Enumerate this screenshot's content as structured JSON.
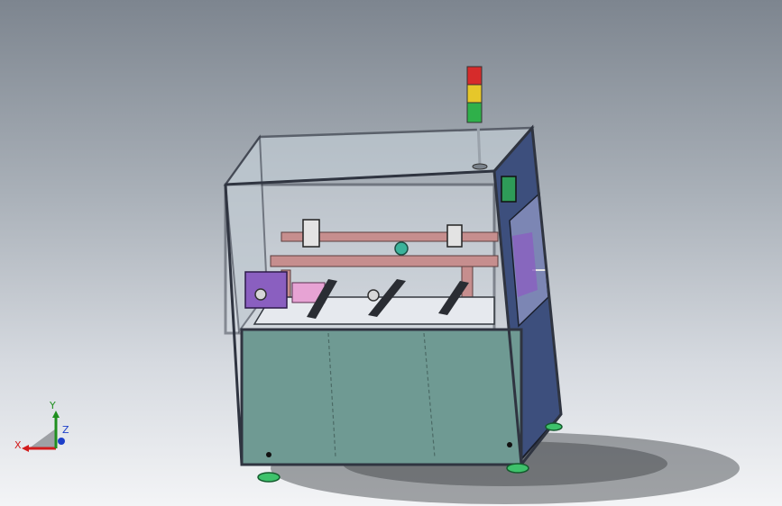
{
  "viewport": {
    "background_top": "#7d858f",
    "background_bottom": "#f3f4f6"
  },
  "model": {
    "frame_color": "#2f3440",
    "panel_color": "#6f9a93",
    "door_color": "#3d4f7d",
    "cover_color": "#c7d2da",
    "carriage_color": "#8a5fc0",
    "rail_color": "#c68e8e",
    "foot_color": "#3ec26b",
    "stack_light": [
      "#d62b2b",
      "#e6c72a",
      "#2fb04a"
    ]
  },
  "triad": {
    "x_label": "X",
    "y_label": "Y",
    "z_label": "Z",
    "x_color": "#d21c1c",
    "y_color": "#1f8f1f",
    "z_color": "#1d3fc9"
  }
}
